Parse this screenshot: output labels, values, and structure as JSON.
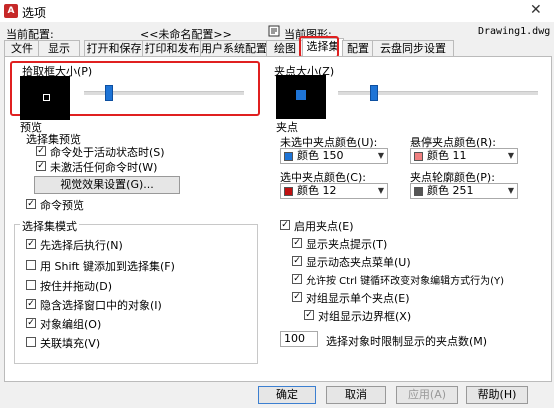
{
  "window": {
    "title": "选项",
    "logo_text": "A"
  },
  "header": {
    "current_profile_label": "当前配置:",
    "current_profile_value": "<<未命名配置>>",
    "current_drawing_label": "当前图形:",
    "current_drawing_value": "Drawing1.dwg"
  },
  "tabs": [
    {
      "label": "文件"
    },
    {
      "label": "显示"
    },
    {
      "label": "打开和保存"
    },
    {
      "label": "打印和发布"
    },
    {
      "label": "用户系统配置"
    },
    {
      "label": "绘图"
    },
    {
      "label": "选择集"
    },
    {
      "label": "配置"
    },
    {
      "label": "云盘同步设置"
    }
  ],
  "pickbox": {
    "label": "拾取框大小(P)",
    "level": 0.2
  },
  "gripsize": {
    "label": "夹点大小(Z)",
    "level": 0.3
  },
  "preview": {
    "group_label": "预览",
    "sub_label": "选择集预览",
    "opt1": "命令处于活动状态时(S)",
    "opt2": "未激活任何命令时(W)",
    "button": "视觉效果设置(G)...",
    "opt3": "命令预览"
  },
  "selection_modes": {
    "group_label": "选择集模式",
    "items": [
      {
        "label": "先选择后执行(N)",
        "checked": true
      },
      {
        "label": "用 Shift 键添加到选择集(F)",
        "checked": false
      },
      {
        "label": "按住并拖动(D)",
        "checked": false
      },
      {
        "label": "隐含选择窗口中的对象(I)",
        "checked": true
      },
      {
        "label": "对象编组(O)",
        "checked": true
      },
      {
        "label": "关联填充(V)",
        "checked": false
      }
    ]
  },
  "grips": {
    "group_label": "夹点",
    "unselected_label": "未选中夹点颜色(U):",
    "unselected_value": "颜色 150",
    "unselected_color": "#1e74d6",
    "hover_label": "悬停夹点颜色(R):",
    "hover_value": "颜色 11",
    "hover_color": "#f08080",
    "selected_label": "选中夹点颜色(C):",
    "selected_value": "颜色 12",
    "selected_color": "#c01010",
    "contour_label": "夹点轮廓颜色(P):",
    "contour_value": "颜色 251",
    "contour_color": "#555555",
    "enable": "启用夹点(E)",
    "tips": "显示夹点提示(T)",
    "dynamic_menu": "显示动态夹点菜单(U)",
    "ctrl_cycle": "允许按 Ctrl 键循环改变对象编辑方式行为(Y)",
    "group_single": "对组显示单个夹点(E)",
    "group_bbox": "对组显示边界框(X)",
    "limit_value": "100",
    "limit_label": "选择对象时限制显示的夹点数(M)"
  },
  "footer": {
    "ok": "确定",
    "cancel": "取消",
    "apply": "应用(A)",
    "help": "帮助(H)"
  }
}
